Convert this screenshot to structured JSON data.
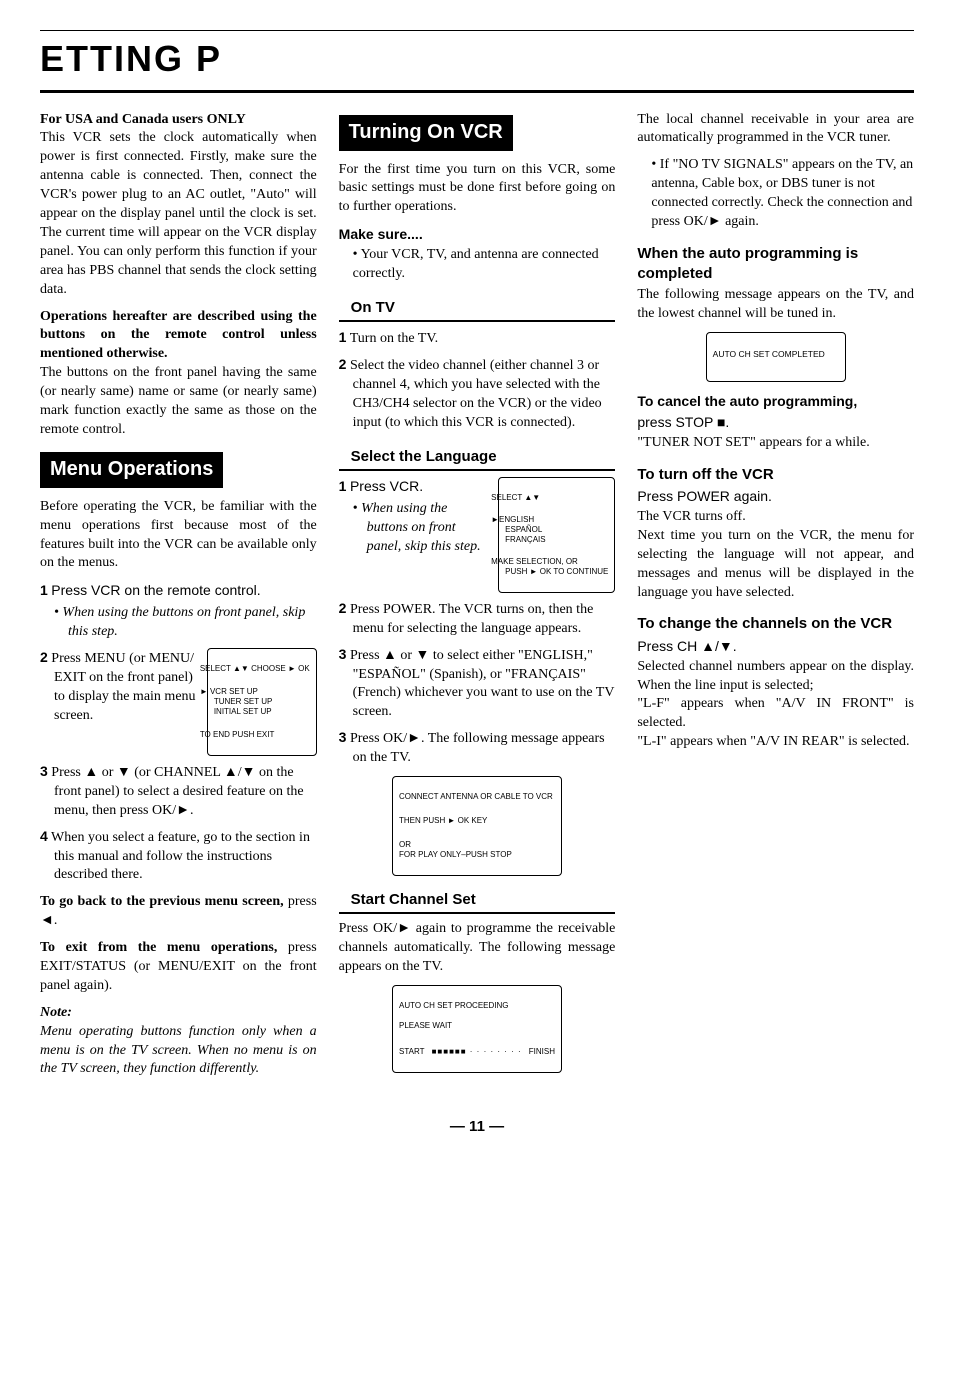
{
  "page_title": "ETTING   P",
  "col1": {
    "usa_head": "For USA and Canada users ONLY",
    "usa_body": "This VCR sets the clock automatically when power is first connected. Firstly, make sure the antenna cable is connected. Then, connect the VCR's power plug to an AC outlet, \"Auto\" will appear on the display panel until the clock is set. The current time will appear on the VCR display panel. You can only perform this function if your area has PBS channel that sends the clock setting data.",
    "ops_bold": "Operations hereafter are described using the buttons on the remote control unless mentioned otherwise.",
    "ops_body": "The buttons on the front panel having the same (or nearly same) name or same (or nearly same) mark function exactly the same as those on the remote control.",
    "menu_band": "Menu Operations",
    "menu_intro": "Before operating the VCR, be familiar with the menu operations first because most of the features built into the VCR can be available only on the menus.",
    "menu_step1": "Press VCR on the remote control.",
    "menu_step1_note": "When using the buttons on front panel, skip this step.",
    "menu_step2": "Press MENU (or MENU/ EXIT on the front panel) to display the main menu screen.",
    "menu_osd_top": "SELECT ▲▼  CHOOSE ► OK",
    "menu_osd_body": "► VCR SET UP\n   TUNER SET UP\n   INITIAL SET UP",
    "menu_osd_foot": "TO END PUSH EXIT",
    "menu_step3": "Press ▲ or ▼ (or CHANNEL ▲/▼ on the front panel) to select a desired feature on the menu, then press OK/►.",
    "menu_step4": "When you select a feature, go to the section in this manual and follow the instructions described there.",
    "menu_back_head": "To go back to the previous menu screen,",
    "menu_back_body": "press ◄.",
    "menu_exit_head": "To exit from the menu operations,",
    "menu_exit_body": "press EXIT/STATUS (or MENU/EXIT on the front panel again).",
    "note_head": "Note:",
    "note_body": "Menu operating buttons function only when a menu is on the TV screen. When no menu is on the TV screen, they function differently."
  },
  "col2": {
    "turn_band": "Turning On VCR",
    "turn_intro": "For the first time you turn on this VCR, some basic settings must be done first before going on to further operations.",
    "make_sure_head": "Make sure....",
    "make_sure_item": "Your VCR, TV, and antenna are connected correctly.",
    "ontv_head": "On TV",
    "ontv_step1": "Turn on the TV.",
    "ontv_step2": "Select the video channel (either channel 3 or channel 4, which you have selected with the CH3/CH4 selector on the VCR) or the video input (to which this VCR is connected).",
    "lang_head": "Select the Language",
    "lang_step1": "Press VCR.",
    "lang_step1_note": "When using the buttons on front panel, skip this step.",
    "lang_osd_top": "SELECT ▲▼",
    "lang_osd_body": "►ENGLISH\n  ESPAÑOL\n  FRANÇAIS",
    "lang_osd_foot": "MAKE SELECTION, OR\nPUSH ► OK TO CONTINUE",
    "lang_step2": "Press POWER.\nThe VCR turns on, then the menu for selecting the language appears.",
    "lang_step3a": "Press ▲ or ▼ to select either \"ENGLISH,\" \"ESPAÑOL\" (Spanish), or \"FRANÇAIS\" (French) whichever you want to use on the TV screen.",
    "lang_step3b": "Press OK/►.\nThe following message appears on the TV.",
    "connect_osd_l1": "CONNECT ANTENNA OR CABLE TO VCR",
    "connect_osd_l2": "THEN PUSH ► OK KEY",
    "connect_osd_l3": "OR\nFOR PLAY ONLY–PUSH STOP",
    "start_head": "Start Channel Set",
    "start_body": "Press OK/► again to programme the receivable channels automatically. The following message appears on the TV.",
    "proc_osd_l1": "AUTO CH SET PROCEEDING",
    "proc_osd_l2": "PLEASE WAIT",
    "proc_start": "START",
    "proc_bar": "■■■■■■ · · · · · · · ·",
    "proc_finish": "FINISH"
  },
  "col3": {
    "local_body": "The local channel receivable in your area are automatically programmed in the VCR tuner.",
    "no_tv": "If \"NO TV SIGNALS\" appears on the TV, an antenna, Cable box, or DBS tuner is not connected correctly. Check the connection and press OK/► again.",
    "auto_done_head": "When the auto programming is completed",
    "auto_done_body": "The following message appears on the TV, and the lowest channel will be tuned in.",
    "done_osd": "AUTO CH SET COMPLETED",
    "cancel_head": "To cancel the auto programming,",
    "cancel_body1": "press STOP ■.",
    "cancel_body2": "\"TUNER NOT SET\" appears for a while.",
    "off_head": "To turn off the VCR",
    "off_l1": "Press POWER again.",
    "off_l2": "The VCR turns off.",
    "off_l3": "Next time you turn on the VCR, the menu for selecting the language will not appear, and messages and menus will be displayed in the language you have selected.",
    "ch_head": "To change the channels on the VCR",
    "ch_l1": "Press CH ▲/▼.",
    "ch_l2": "Selected channel numbers appear on the display. When the line input is selected;",
    "ch_l3": "\"L-F\" appears when \"A/V IN FRONT\" is selected.",
    "ch_l4": "\"L-I\" appears when \"A/V IN REAR\" is selected."
  },
  "page_number": "— 11 —"
}
